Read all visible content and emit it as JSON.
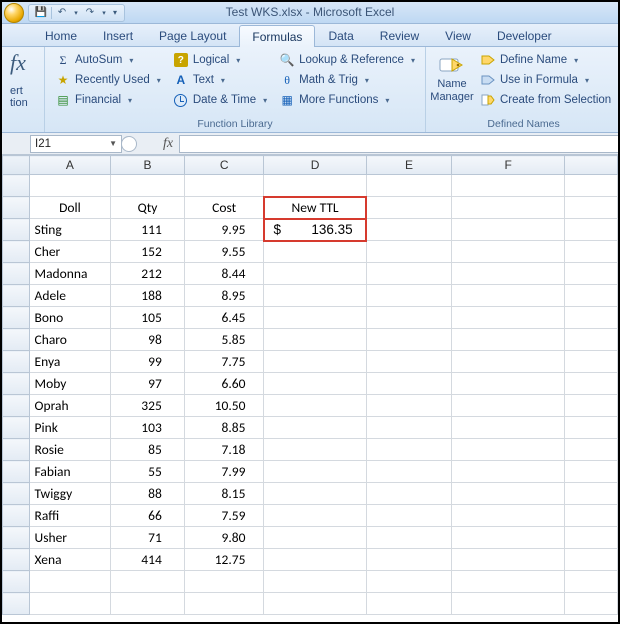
{
  "title": "Test WKS.xlsx - Microsoft Excel",
  "tabs": {
    "home": "Home",
    "insert": "Insert",
    "page_layout": "Page Layout",
    "formulas": "Formulas",
    "data": "Data",
    "review": "Review",
    "view": "View",
    "developer": "Developer"
  },
  "ribbon": {
    "fx": {
      "line1": "ert",
      "line2": "tion"
    },
    "lib": {
      "autosum": "AutoSum",
      "recent": "Recently Used",
      "financial": "Financial",
      "logical": "Logical",
      "text": "Text",
      "datetime": "Date & Time",
      "lookup": "Lookup & Reference",
      "math": "Math & Trig",
      "more": "More Functions",
      "group": "Function Library"
    },
    "names": {
      "manager_l1": "Name",
      "manager_l2": "Manager",
      "define": "Define Name",
      "use": "Use in Formula",
      "create": "Create from Selection",
      "group": "Defined Names"
    }
  },
  "fbar": {
    "namebox": "I21",
    "fx": "fx",
    "formula": ""
  },
  "cols": [
    "A",
    "B",
    "C",
    "D",
    "E",
    "F"
  ],
  "headers": {
    "doll": "Doll",
    "qty": "Qty",
    "cost": "Cost",
    "ttl": "New TTL"
  },
  "highlight": {
    "currency": "$",
    "value": "136.35"
  },
  "rows": [
    {
      "doll": "Sting",
      "qty": "111",
      "cost": "9.95"
    },
    {
      "doll": "Cher",
      "qty": "152",
      "cost": "9.55"
    },
    {
      "doll": "Madonna",
      "qty": "212",
      "cost": "8.44"
    },
    {
      "doll": "Adele",
      "qty": "188",
      "cost": "8.95"
    },
    {
      "doll": "Bono",
      "qty": "105",
      "cost": "6.45"
    },
    {
      "doll": "Charo",
      "qty": "98",
      "cost": "5.85"
    },
    {
      "doll": "Enya",
      "qty": "99",
      "cost": "7.75"
    },
    {
      "doll": "Moby",
      "qty": "97",
      "cost": "6.60"
    },
    {
      "doll": "Oprah",
      "qty": "325",
      "cost": "10.50"
    },
    {
      "doll": "Pink",
      "qty": "103",
      "cost": "8.85"
    },
    {
      "doll": "Rosie",
      "qty": "85",
      "cost": "7.18"
    },
    {
      "doll": "Fabian",
      "qty": "55",
      "cost": "7.99"
    },
    {
      "doll": "Twiggy",
      "qty": "88",
      "cost": "8.15"
    },
    {
      "doll": "Raffi",
      "qty": "66",
      "cost": "7.59"
    },
    {
      "doll": "Usher",
      "qty": "71",
      "cost": "9.80"
    },
    {
      "doll": "Xena",
      "qty": "414",
      "cost": "12.75"
    }
  ]
}
